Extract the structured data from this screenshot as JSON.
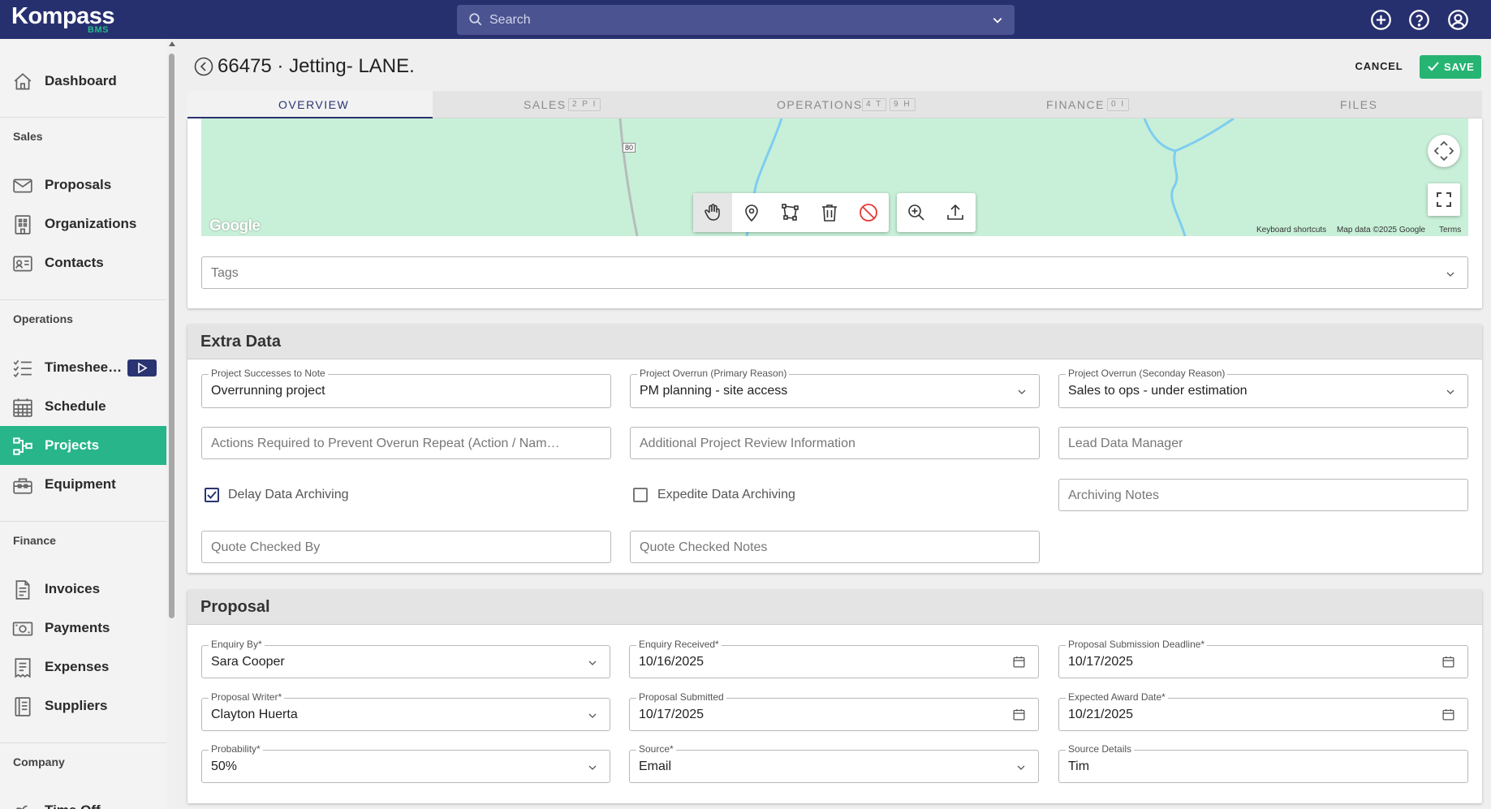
{
  "brand": {
    "name": "Kompass",
    "sub": "BMS",
    "accent": "#25b98a",
    "nav_bg": "#27306f"
  },
  "search": {
    "placeholder": "Search"
  },
  "sidebar": {
    "top": [
      {
        "label": "Dashboard",
        "icon": "home-icon"
      }
    ],
    "sections": [
      {
        "title": "Sales",
        "items": [
          {
            "label": "Proposals",
            "icon": "envelope-icon"
          },
          {
            "label": "Organizations",
            "icon": "building-icon"
          },
          {
            "label": "Contacts",
            "icon": "id-card-icon"
          }
        ]
      },
      {
        "title": "Operations",
        "items": [
          {
            "label": "Timeshee…",
            "icon": "checklist-icon"
          },
          {
            "label": "Schedule",
            "icon": "calendar-grid-icon"
          },
          {
            "label": "Projects",
            "icon": "network-icon",
            "active": true
          },
          {
            "label": "Equipment",
            "icon": "toolbox-icon"
          }
        ]
      },
      {
        "title": "Finance",
        "items": [
          {
            "label": "Invoices",
            "icon": "invoice-icon"
          },
          {
            "label": "Payments",
            "icon": "cash-icon"
          },
          {
            "label": "Expenses",
            "icon": "receipt-icon"
          },
          {
            "label": "Suppliers",
            "icon": "ledger-icon"
          }
        ]
      },
      {
        "title": "Company",
        "items": [
          {
            "label": "Time Off",
            "icon": "time-off-icon"
          }
        ]
      }
    ]
  },
  "header": {
    "title": "66475 · Jetting- LANE.",
    "cancel": "CANCEL",
    "save": "SAVE"
  },
  "tabs": [
    {
      "label": "OVERVIEW",
      "active": true
    },
    {
      "label": "SALES",
      "badges": [
        "2 P I"
      ]
    },
    {
      "label": "OPERATIONS",
      "badges": [
        "4 T",
        "9 H"
      ]
    },
    {
      "label": "FINANCE",
      "badges": [
        "0 I"
      ]
    },
    {
      "label": "FILES"
    }
  ],
  "map": {
    "road_marker": "80",
    "watermark": "Google",
    "keyboard": "Keyboard shortcuts",
    "mapdata": "Map data ©2025 Google",
    "terms": "Terms"
  },
  "tags": {
    "placeholder": "Tags"
  },
  "extra": {
    "title": "Extra Data",
    "successes": {
      "label": "Project Successes to Note",
      "value": "Overrunning project"
    },
    "overrun_primary": {
      "label": "Project Overrun (Primary Reason)",
      "value": "PM planning - site access"
    },
    "overrun_secondary": {
      "label": "Project Overrun (Seconday Reason)",
      "value": "Sales to ops - under estimation"
    },
    "actions_ph": "Actions Required to Prevent Overun Repeat (Action / Nam…",
    "review_ph": "Additional Project Review Information",
    "lead_ph": "Lead Data Manager",
    "delay_archiving": {
      "label": "Delay Data Archiving",
      "checked": true
    },
    "expedite_archiving": {
      "label": "Expedite Data Archiving",
      "checked": false
    },
    "archiving_notes_ph": "Archiving Notes",
    "quote_by_ph": "Quote Checked By",
    "quote_notes_ph": "Quote Checked Notes"
  },
  "proposal": {
    "title": "Proposal",
    "enquiry_by": {
      "label": "Enquiry By*",
      "value": "Sara Cooper"
    },
    "enquiry_received": {
      "label": "Enquiry Received*",
      "value": "10/16/2025"
    },
    "submission_deadline": {
      "label": "Proposal Submission Deadline*",
      "value": "10/17/2025"
    },
    "writer": {
      "label": "Proposal Writer*",
      "value": "Clayton Huerta"
    },
    "submitted": {
      "label": "Proposal Submitted",
      "value": "10/17/2025"
    },
    "award_date": {
      "label": "Expected Award Date*",
      "value": "10/21/2025"
    },
    "probability": {
      "label": "Probability*",
      "value": "50%"
    },
    "source": {
      "label": "Source*",
      "value": "Email"
    },
    "source_details": {
      "label": "Source Details",
      "value": "Tim"
    }
  }
}
